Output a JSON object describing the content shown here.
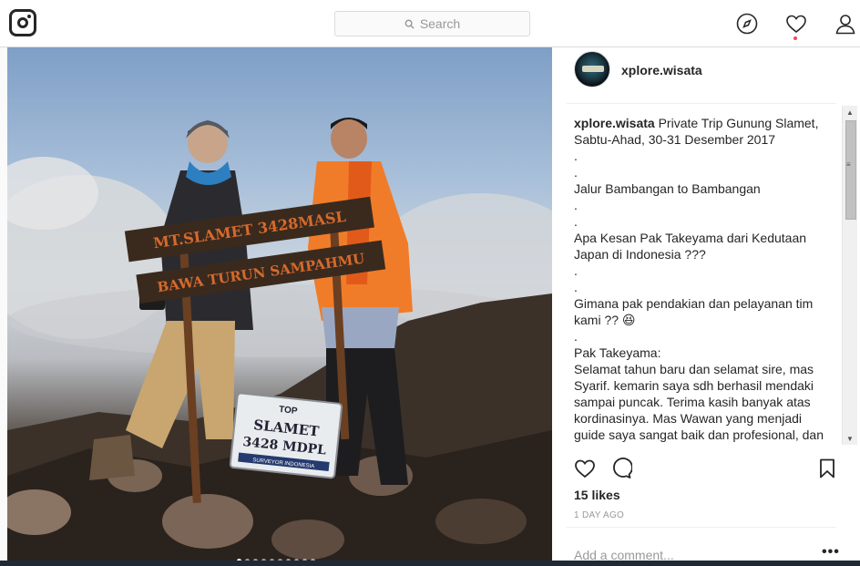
{
  "nav": {
    "search_placeholder": "Search"
  },
  "post": {
    "username": "xplore.wisata",
    "caption_lines": [
      "Private Trip Gunung Slamet,",
      "Sabtu-Ahad, 30-31 Desember 2017",
      ".",
      ".",
      "Jalur Bambangan to Bambangan",
      ".",
      ".",
      "Apa Kesan Pak Takeyama dari Kedutaan",
      "Japan di Indonesia ???",
      ".",
      ".",
      "Gimana pak pendakian dan pelayanan tim",
      "kami ?? 😆",
      ".",
      "Pak Takeyama:",
      "Selamat tahun baru dan selamat sire, mas",
      "Syarif. kemarin saya sdh berhasil mendaki",
      "sampai puncak. Terima kasih banyak atas",
      "kordinasinya. Mas Wawan yang menjadi",
      "guide saya sangat baik dan profesional, dan"
    ],
    "likes": "15 likes",
    "time_ago": "1 DAY AGO",
    "comment_placeholder": "Add a comment...",
    "more_label": "•••",
    "carousel": {
      "count": 10,
      "active_index": 0
    }
  },
  "photo_signs": {
    "sign_top": "MT.SLAMET 3428MASL",
    "sign_bottom": "BAWA TURUN SAMPAHMU",
    "plaque_brand": "TOP",
    "plaque_name": "SLAMET",
    "plaque_height": "3428 MDPL",
    "plaque_footer": "SURVEYOR INDONESIA"
  },
  "colors": {
    "notification": "#ed4956",
    "text": "#262626",
    "muted": "#999999",
    "border": "#dbdbdb"
  },
  "icons": [
    "instagram-logo-icon",
    "search-icon",
    "explore-compass-icon",
    "heart-icon",
    "profile-icon",
    "like-heart-icon",
    "comment-icon",
    "bookmark-icon"
  ]
}
